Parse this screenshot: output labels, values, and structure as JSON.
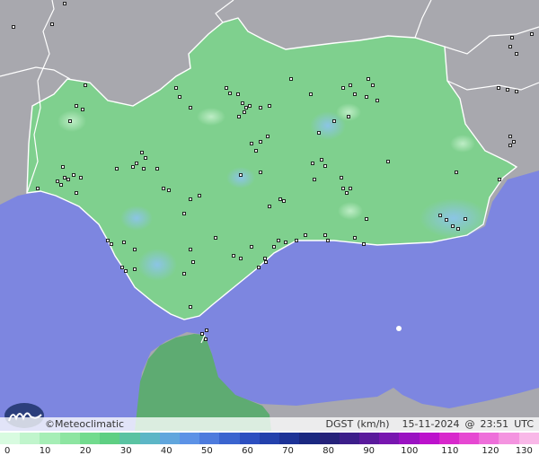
{
  "map": {
    "brand": "Meteoclimatic",
    "brand_symbol": "©",
    "variable": "DGST",
    "unit": "(km/h)",
    "date": "15-11-2024",
    "at": "@",
    "time": "23:51",
    "timezone": "UTC",
    "colors": {
      "sea": "#7d86e0",
      "land_outside": "#a8a8ae",
      "region": "#7fd08e",
      "africa": "#5eab72"
    }
  },
  "legend": {
    "ticks": [
      "0",
      "10",
      "20",
      "30",
      "40",
      "50",
      "60",
      "70",
      "80",
      "90",
      "100",
      "110",
      "120",
      "130"
    ],
    "colors": [
      "#d8fbe0",
      "#c0f5cc",
      "#a6eeb6",
      "#8de5a1",
      "#72db8e",
      "#5ecf83",
      "#5ac3a2",
      "#5cb6c6",
      "#61a6dd",
      "#5c92e6",
      "#4d7bdd",
      "#3a64cf",
      "#2c4fc0",
      "#2341ac",
      "#1d3397",
      "#1a2880",
      "#25227a",
      "#3c1e8a",
      "#5a1a9c",
      "#7816b0",
      "#9a12c2",
      "#bc12cc",
      "#d828cc",
      "#e648d2",
      "#ee6fda",
      "#f494e0",
      "#f9b8e8"
    ]
  }
}
